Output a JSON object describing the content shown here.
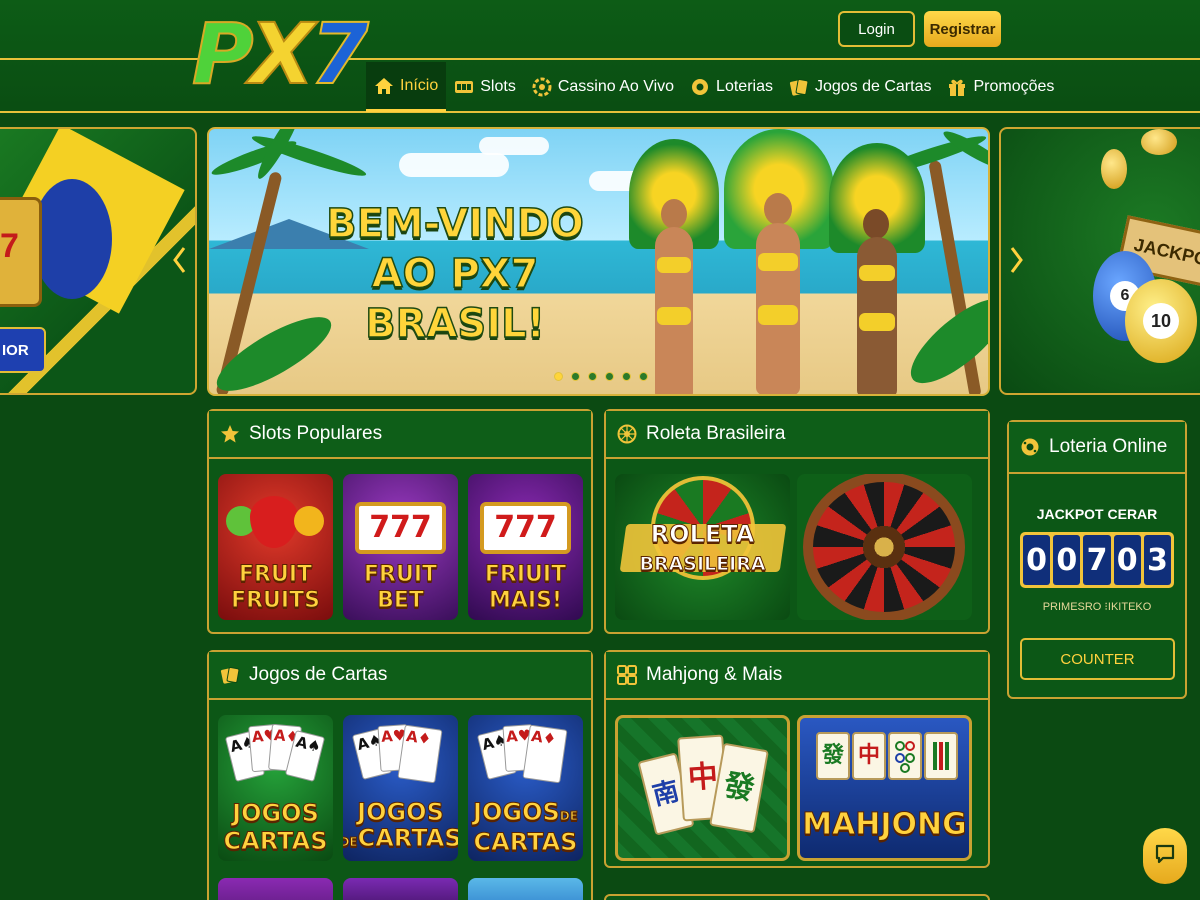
{
  "header": {
    "logo": {
      "p": "P",
      "x": "X",
      "n": "7"
    },
    "login_label": "Login",
    "register_label": "Registrar"
  },
  "nav": [
    {
      "label": "Início",
      "icon": "home-icon",
      "active": true
    },
    {
      "label": "Slots",
      "icon": "slot-machine-icon"
    },
    {
      "label": "Cassino Ao Vivo",
      "icon": "chip-icon"
    },
    {
      "label": "Loterias",
      "icon": "lottery-ball-icon"
    },
    {
      "label": "Jogos de Cartas",
      "icon": "cards-icon"
    },
    {
      "label": "Promoções",
      "icon": "gift-icon"
    }
  ],
  "banner": {
    "title": "BEM-VINDO AO PX7 BRASIL!",
    "left_card_button": "IOR",
    "right_card_sign": "JACKPO",
    "right_card_balls": [
      "6",
      "10"
    ],
    "dots_total": 6,
    "dot_active": 0
  },
  "sections": {
    "slots": {
      "title": "Slots Populares",
      "icon": "star-icon",
      "tiles": [
        {
          "label1": "FRUIT",
          "label2": "FRUITS"
        },
        {
          "label1": "FRUIT",
          "label2": "BET",
          "reels": "777"
        },
        {
          "label1": "FRIUIT",
          "label2": "MAIS!",
          "reels": "777"
        }
      ]
    },
    "roleta": {
      "title": "Roleta Brasileira",
      "icon": "roulette-icon",
      "tiles": [
        {
          "label1": "ROLETA",
          "label2": "BRASILEIRA"
        }
      ]
    },
    "cartas": {
      "title": "Jogos de Cartas",
      "icon": "cards-icon",
      "tiles": [
        {
          "label1": "JOGOS",
          "label2": "CARTAS"
        },
        {
          "label1": "JOGOS",
          "small": "DE",
          "label2": "CARTAS"
        },
        {
          "label1": "JOGOS",
          "small": "DE",
          "label2": "CARTAS"
        }
      ],
      "card_faces": [
        "A♠",
        "A♥",
        "A♦",
        "A♠"
      ]
    },
    "mahjong": {
      "title": "Mahjong & Mais",
      "icon": "mahjong-icon",
      "tiles": [
        {
          "glyphs": [
            "南",
            "中",
            "發"
          ]
        },
        {
          "label": "MAHJONG",
          "glyphs": [
            "發",
            "中"
          ]
        }
      ]
    }
  },
  "lottery": {
    "title": "Loteria Online",
    "icon": "lottery-ball-icon",
    "jackpot_label": "JACKPOT CERAR",
    "digits": [
      "0",
      "0",
      "7",
      "0",
      "3"
    ],
    "sub_label": "PRIMESRO ⁝IKITEKO",
    "button": "COUNTER"
  },
  "colors": {
    "accent_gold": "#e3bd36",
    "bg_green": "#0b4a12",
    "digit_blue": "#102f7a"
  }
}
